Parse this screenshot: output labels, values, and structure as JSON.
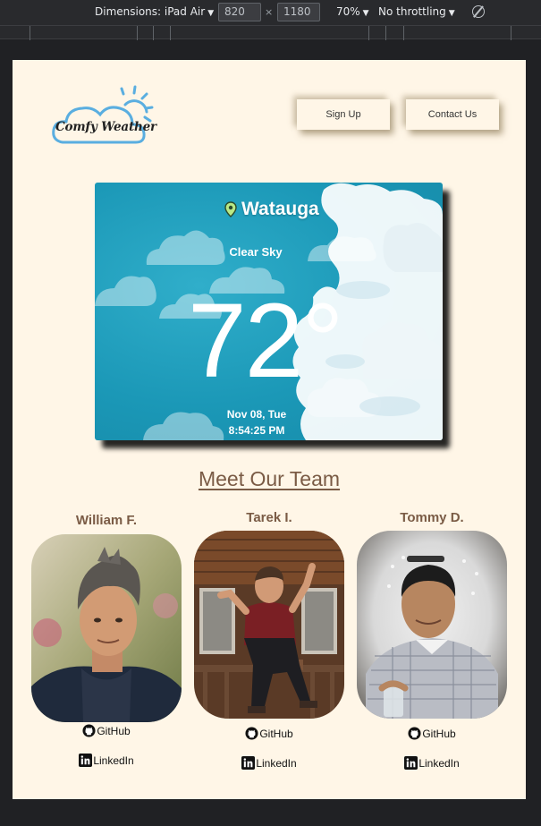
{
  "devtools": {
    "dimensions_label": "Dimensions: iPad Air",
    "width": "820",
    "height": "1180",
    "zoom": "70%",
    "throttling": "No throttling"
  },
  "header": {
    "logo_text": "Comfy Weather",
    "signup_label": "Sign Up",
    "contact_label": "Contact Us"
  },
  "weather": {
    "city": "Watauga",
    "description": "Clear Sky",
    "temperature": "72°",
    "date": "Nov 08, Tue",
    "time": "8:54:25 PM"
  },
  "team": {
    "title": "Meet Our Team",
    "members": [
      {
        "name": "William F.",
        "github": "GitHub",
        "linkedin": "LinkedIn"
      },
      {
        "name": "Tarek I.",
        "github": "GitHub",
        "linkedin": "LinkedIn"
      },
      {
        "name": "Tommy D.",
        "github": "GitHub",
        "linkedin": "LinkedIn"
      }
    ]
  },
  "colors": {
    "page_bg": "#fff6e7",
    "heading": "#7a5b45",
    "sky": "#1b98b7",
    "logo_blue": "#5aaee0",
    "pin": "#b8e986"
  }
}
